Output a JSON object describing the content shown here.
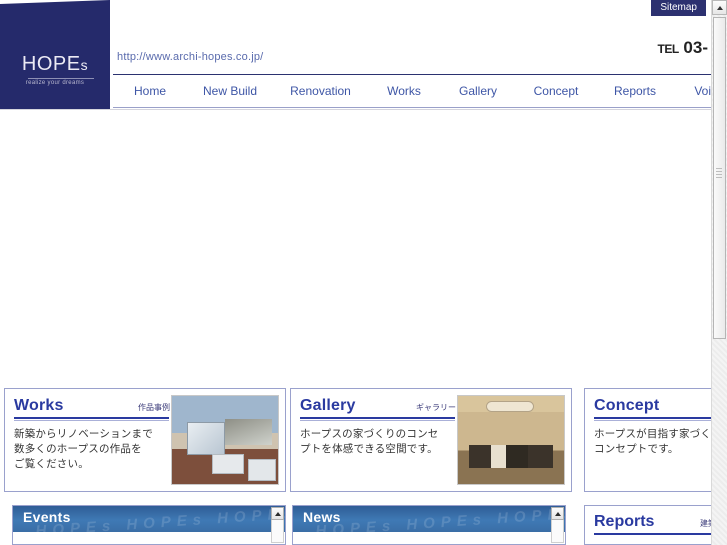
{
  "site": {
    "logo_word": "HOPE",
    "logo_word_small": "s",
    "tagline": "realize your dreams",
    "url": "http://www.archi-hopes.co.jp/",
    "sitemap_label": "Sitemap",
    "tel_label": "TEL",
    "tel_number": "03-"
  },
  "nav": {
    "items": [
      {
        "label": "Home"
      },
      {
        "label": "New Build"
      },
      {
        "label": "Renovation"
      },
      {
        "label": "Works"
      },
      {
        "label": "Gallery"
      },
      {
        "label": "Concept"
      },
      {
        "label": "Reports"
      },
      {
        "label": "Voice"
      }
    ]
  },
  "cards": [
    {
      "title": "Works",
      "subtitle_jp": "作品事例",
      "text": "新築からリノベーションまで\n数多くのホープスの作品を\nご覧ください。",
      "thumb": "works-rooftop-terrace-photo"
    },
    {
      "title": "Gallery",
      "subtitle_jp": "ギャラリー",
      "text": "ホープスの家づくりのコンセ\nプトを体感できる空間です。",
      "thumb": "gallery-interior-dining-photo"
    },
    {
      "title": "Concept",
      "subtitle_jp": "",
      "text": "ホープスが目指す家づく\nコンセプトです。",
      "thumb": ""
    }
  ],
  "bottom_panels": [
    {
      "title": "Events",
      "watermark": "HOPEs  HOPEs  HOPEs  HOPEs"
    },
    {
      "title": "News",
      "watermark": "HOPEs  HOPEs  HOPEs  HOPEs"
    }
  ],
  "reports_card": {
    "title": "Reports",
    "subtitle_jp": "建築"
  },
  "colors": {
    "navy": "#252a6b",
    "nav_link": "#3e56a6",
    "card_title": "#2a3aa0",
    "panel_blue": "#3f79b5",
    "sitemap_bg": "#2c3170"
  },
  "icons": {
    "scroll_up": "triangle-up-icon"
  }
}
